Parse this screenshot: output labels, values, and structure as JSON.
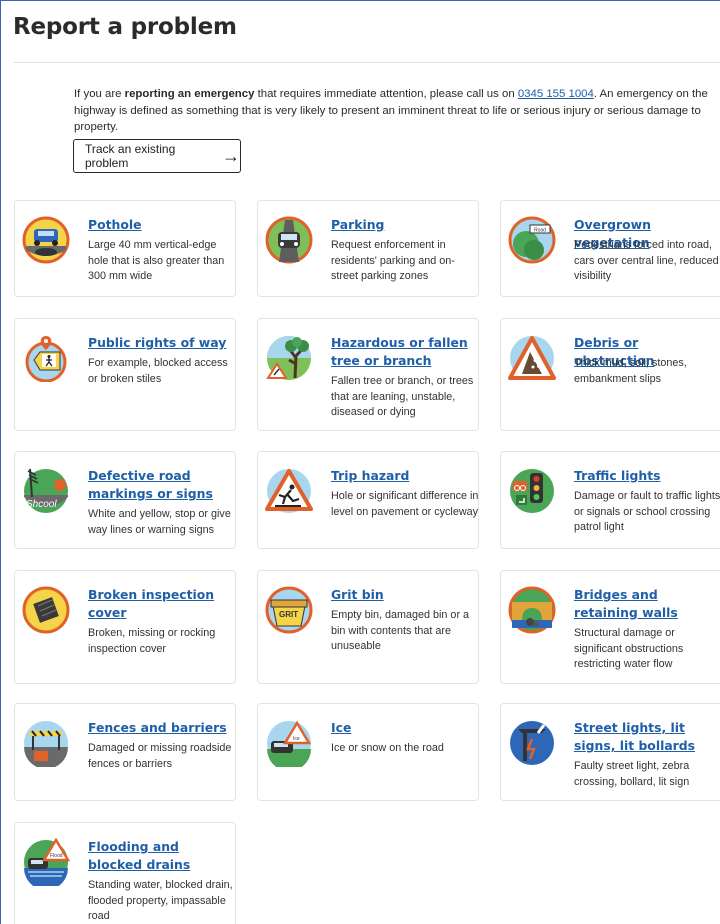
{
  "page": {
    "title": "Report a problem",
    "intro_pre": "If you are ",
    "intro_bold": "reporting an emergency",
    "intro_mid": " that requires immediate attention, please call us on ",
    "phone": "0345 155 1004",
    "intro_post": ". An emergency on the highway is defined as something that is very likely to present an imminent threat to life or serious injury or serious damage to property.",
    "track_button": "Track an existing problem"
  },
  "cards": [
    {
      "title": "Pothole",
      "desc": "Large 40 mm vertical-edge hole that is also greater than 300 mm wide",
      "icon": "pothole-icon"
    },
    {
      "title": "Parking",
      "desc": "Request enforcement in residents' parking and on-street parking zones",
      "icon": "parking-icon"
    },
    {
      "title": "Overgrown vegetation",
      "desc": "Pedestrians forced into road, cars over central line, reduced visibility",
      "icon": "vegetation-icon"
    },
    {
      "title": "Public rights of way",
      "desc": "For example, blocked access or broken stiles",
      "icon": "rights-of-way-icon"
    },
    {
      "title": "Hazardous or fallen tree or branch",
      "desc": "Fallen tree or branch, or trees that are leaning, unstable, diseased or dying",
      "icon": "fallen-tree-icon"
    },
    {
      "title": "Debris or obstruction",
      "desc": "Thick mud, soil, stones, embankment slips",
      "icon": "debris-icon"
    },
    {
      "title": "Defective road markings or signs",
      "desc": "White and yellow, stop or give way lines or warning signs",
      "icon": "road-markings-icon",
      "icon_text": "Shcool"
    },
    {
      "title": "Trip hazard",
      "desc": "Hole or significant difference in level on pavement or cycleway",
      "icon": "trip-hazard-icon"
    },
    {
      "title": "Traffic lights",
      "desc": "Damage or fault to traffic lights or signals or school crossing patrol light",
      "icon": "traffic-lights-icon"
    },
    {
      "title": "Broken inspection cover",
      "desc": "Broken, missing or rocking inspection cover",
      "icon": "inspection-cover-icon"
    },
    {
      "title": "Grit bin",
      "desc": "Empty bin, damaged bin or a bin with contents that are unuseable",
      "icon": "grit-bin-icon",
      "icon_text": "GRIT"
    },
    {
      "title": "Bridges and retaining walls",
      "desc": "Structural damage or significant obstructions restricting water flow",
      "icon": "bridge-icon"
    },
    {
      "title": "Fences and barriers",
      "desc": "Damaged or missing roadside fences or barriers",
      "icon": "fence-icon"
    },
    {
      "title": "Ice",
      "desc": "Ice or snow on the road",
      "icon": "ice-icon",
      "icon_text": "Ice"
    },
    {
      "title": "Street lights, lit signs, lit bollards",
      "desc": "Faulty street light, zebra crossing, bollard, lit sign",
      "icon": "street-light-icon"
    },
    {
      "title": "Flooding and blocked drains",
      "desc": "Standing water, blocked drain, flooded property, impassable road",
      "icon": "flooding-icon",
      "icon_text": "Flood"
    }
  ],
  "colors": {
    "link": "#1f5fa8",
    "icon_ring": "#e0622a",
    "frame": "#3a66b0"
  }
}
